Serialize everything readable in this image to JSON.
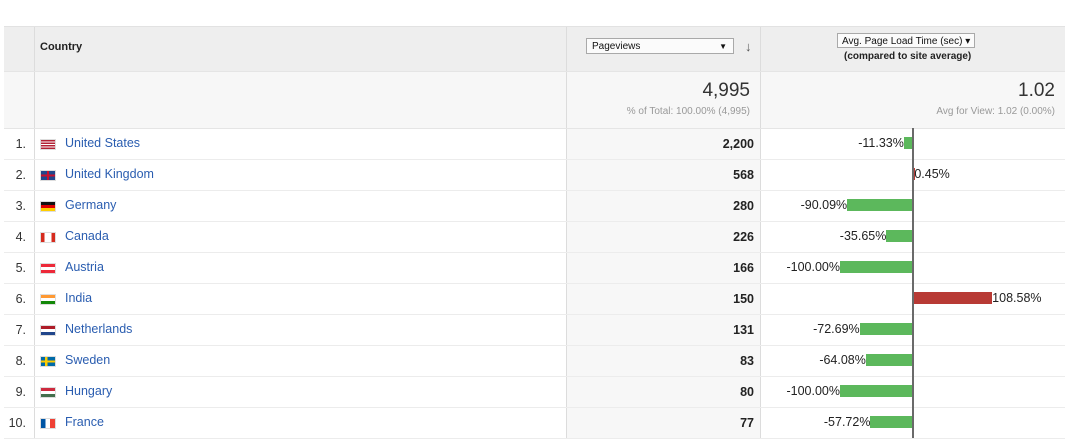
{
  "header": {
    "country_label": "Country",
    "metric_select": "Pageviews",
    "compare_select": "Avg. Page Load Time (sec)",
    "compare_sub": "(compared to site average)"
  },
  "summary": {
    "pageviews_total": "4,995",
    "pageviews_pct": "% of Total: 100.00% (4,995)",
    "load_avg": "1.02",
    "load_avg_sub": "Avg for View: 1.02 (0.00%)"
  },
  "colors": {
    "positive_bar": "#b83a35",
    "negative_bar": "#5cb85c",
    "link": "#2a5db0"
  },
  "rows": [
    {
      "rank": "1.",
      "country": "United States",
      "flag": "flag-us-icon",
      "pageviews": "2,200",
      "delta": "-11.33%",
      "delta_value": -11.33
    },
    {
      "rank": "2.",
      "country": "United Kingdom",
      "flag": "flag-uk-icon",
      "pageviews": "568",
      "delta": "0.45%",
      "delta_value": 0.45
    },
    {
      "rank": "3.",
      "country": "Germany",
      "flag": "flag-de-icon",
      "pageviews": "280",
      "delta": "-90.09%",
      "delta_value": -90.09
    },
    {
      "rank": "4.",
      "country": "Canada",
      "flag": "flag-ca-icon",
      "pageviews": "226",
      "delta": "-35.65%",
      "delta_value": -35.65
    },
    {
      "rank": "5.",
      "country": "Austria",
      "flag": "flag-at-icon",
      "pageviews": "166",
      "delta": "-100.00%",
      "delta_value": -100.0
    },
    {
      "rank": "6.",
      "country": "India",
      "flag": "flag-in-icon",
      "pageviews": "150",
      "delta": "108.58%",
      "delta_value": 108.58
    },
    {
      "rank": "7.",
      "country": "Netherlands",
      "flag": "flag-nl-icon",
      "pageviews": "131",
      "delta": "-72.69%",
      "delta_value": -72.69
    },
    {
      "rank": "8.",
      "country": "Sweden",
      "flag": "flag-se-icon",
      "pageviews": "83",
      "delta": "-64.08%",
      "delta_value": -64.08
    },
    {
      "rank": "9.",
      "country": "Hungary",
      "flag": "flag-hu-icon",
      "pageviews": "80",
      "delta": "-100.00%",
      "delta_value": -100.0
    },
    {
      "rank": "10.",
      "country": "France",
      "flag": "flag-fr-icon",
      "pageviews": "77",
      "delta": "-57.72%",
      "delta_value": -57.72
    }
  ]
}
